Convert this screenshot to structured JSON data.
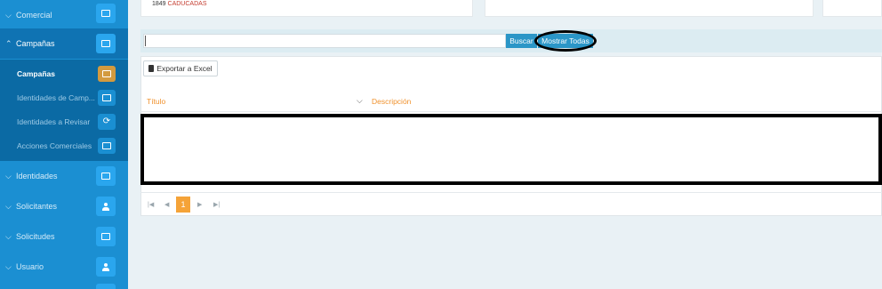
{
  "sidebar": {
    "items": [
      {
        "label": "Comercial",
        "expanded": false,
        "icon": "briefcase-icon"
      },
      {
        "label": "Campañas",
        "expanded": true,
        "icon": "megaphone-icon"
      },
      {
        "label": "Identidades",
        "expanded": false,
        "icon": "id-card-icon"
      },
      {
        "label": "Solicitantes",
        "expanded": false,
        "icon": "users-icon"
      },
      {
        "label": "Solicitudes",
        "expanded": false,
        "icon": "ticket-icon"
      },
      {
        "label": "Usuario",
        "expanded": false,
        "icon": "user-icon"
      }
    ],
    "subitems": [
      {
        "label": "Campañas",
        "icon": "card-icon",
        "current": true
      },
      {
        "label": "Identidades de Camp...",
        "icon": "id-card-icon",
        "current": false
      },
      {
        "label": "Identidades a Revisar",
        "icon": "refresh-icon",
        "current": false
      },
      {
        "label": "Acciones Comerciales",
        "icon": "id-card-icon",
        "current": false
      }
    ]
  },
  "top_card": {
    "count": "1849",
    "status": "CADUCADAS"
  },
  "search": {
    "placeholder": "",
    "value": "",
    "buscar_label": "Buscar",
    "mostrar_todas_label": "Mostrar Todas"
  },
  "toolbar": {
    "export_label": "Exportar a Excel"
  },
  "grid": {
    "columns": [
      {
        "label": "Título"
      },
      {
        "label": "Descripción"
      }
    ],
    "rows": []
  },
  "pager": {
    "first": "|◀",
    "prev": "◀",
    "current_page": "1",
    "next": "▶",
    "last": "▶|"
  },
  "colors": {
    "sidebar": "#1b8fd2",
    "accent_orange": "#f0922e",
    "button_blue": "#2b96c7",
    "active_page": "#f5a338"
  }
}
